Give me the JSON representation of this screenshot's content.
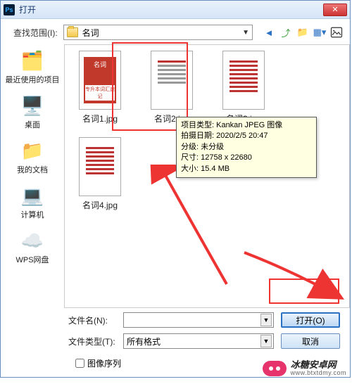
{
  "title": "打开",
  "lookin_label": "查找范围(I):",
  "current_folder": "名词",
  "sidebar": {
    "items": [
      {
        "label": "最近使用的项目"
      },
      {
        "label": "桌面"
      },
      {
        "label": "我的文档"
      },
      {
        "label": "计算机"
      },
      {
        "label": "WPS网盘"
      }
    ]
  },
  "files": [
    {
      "name": "名词1.jpg",
      "thumb_title": "名词",
      "thumb_band": "专升本词汇速记"
    },
    {
      "name": "名词2.jpg"
    },
    {
      "name": "名词3.jpg"
    },
    {
      "name": "名词4.jpg"
    }
  ],
  "tooltip": {
    "l1": "项目类型: Kankan JPEG 图像",
    "l2": "拍摄日期: 2020/2/5 20:47",
    "l3": "分级: 未分级",
    "l4": "尺寸: 12758 x 22680",
    "l5": "大小: 15.4 MB"
  },
  "filename_label": "文件名(N):",
  "filetype_label": "文件类型(T):",
  "filetype_value": "所有格式",
  "open_btn": "打开(O)",
  "cancel_btn": "取消",
  "seq_checkbox": "图像序列",
  "watermark": {
    "name": "冰糖安卓网",
    "url": "www.btxtdmy.com"
  }
}
